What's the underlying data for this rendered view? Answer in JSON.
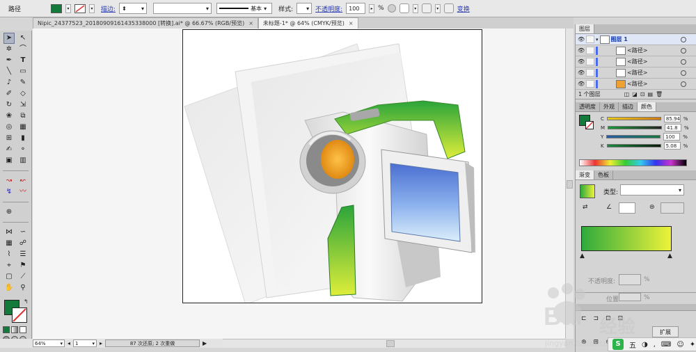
{
  "control_bar": {
    "object_type": "路径",
    "stroke_label": "描边:",
    "profile_label": "基本",
    "style_label": "样式:",
    "opacity_label": "不透明度:",
    "opacity_value": "100",
    "percent": "%",
    "transform_label": "变换",
    "fill_color": "#147a3c"
  },
  "tabs": [
    {
      "label": "Nipic_24377523_20180909161435338000 [转换].ai* @ 66.67% (RGB/预览)",
      "close": "×"
    },
    {
      "label": "未标题-1* @ 64% (CMYK/预览)",
      "close": "×"
    }
  ],
  "status": {
    "zoom": "64%",
    "page": "1",
    "message": "87 次还原; 2 次重做"
  },
  "layers_panel": {
    "tab": "图层",
    "layer_name": "图层 1",
    "paths": [
      "<路径>",
      "<路径>",
      "<路径>",
      "<路径>"
    ],
    "footer": "1 个图层"
  },
  "color_panel": {
    "tabs": [
      "透明度",
      "外观",
      "描边",
      "颜色"
    ],
    "channels": [
      {
        "name": "C",
        "value": "85.94"
      },
      {
        "name": "M",
        "value": "41.8"
      },
      {
        "name": "Y",
        "value": "100"
      },
      {
        "name": "K",
        "value": "5.08"
      }
    ],
    "swatch": "#147a3c"
  },
  "gradient_panel": {
    "tabs": [
      "渐变",
      "色板"
    ],
    "type_label": "类型:",
    "opacity_label": "不透明度:",
    "location_label": "位置:",
    "percent": "%",
    "start_color": "#2eaa3c",
    "end_color": "#eef23a"
  },
  "lower_panel": {
    "expand_label": "扩展"
  },
  "watermark": {
    "brand_text": "经验",
    "url": "jingyan.baidu.com"
  }
}
